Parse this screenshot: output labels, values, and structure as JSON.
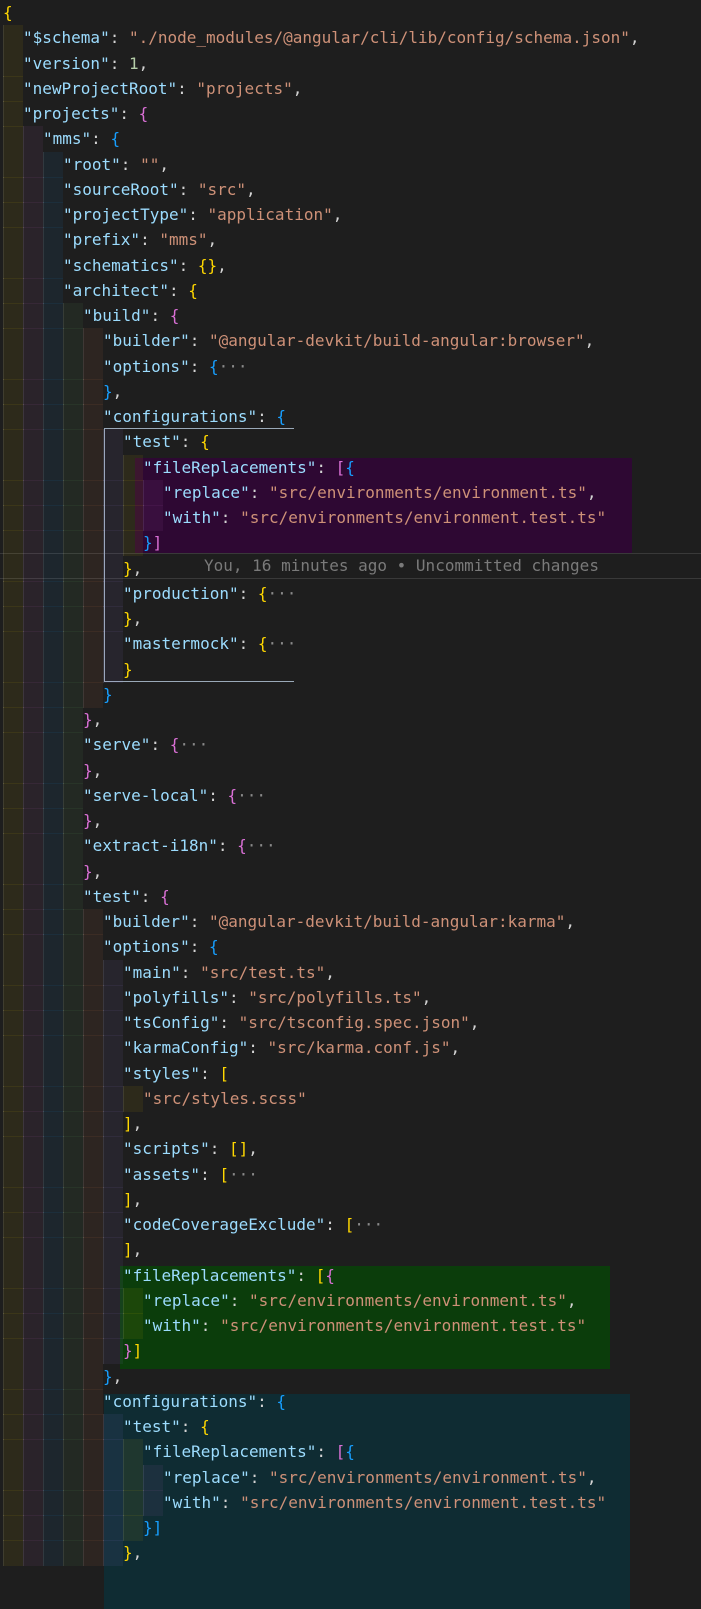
{
  "editor": {
    "blame": "You, 16 minutes ago • Uncommitted changes",
    "lines": [
      {
        "i": 0,
        "t": [
          [
            "p",
            "{",
            1
          ]
        ]
      },
      {
        "i": 1,
        "t": [
          [
            "k",
            "\"$schema\""
          ],
          [
            "w",
            ": "
          ],
          [
            "s",
            "\"./node_modules/@angular/cli/lib/config/schema.json\""
          ],
          [
            "w",
            ","
          ]
        ]
      },
      {
        "i": 1,
        "t": [
          [
            "k",
            "\"version\""
          ],
          [
            "w",
            ": "
          ],
          [
            "n",
            "1"
          ],
          [
            "w",
            ","
          ]
        ]
      },
      {
        "i": 1,
        "t": [
          [
            "k",
            "\"newProjectRoot\""
          ],
          [
            "w",
            ": "
          ],
          [
            "s",
            "\"projects\""
          ],
          [
            "w",
            ","
          ]
        ]
      },
      {
        "i": 1,
        "t": [
          [
            "k",
            "\"projects\""
          ],
          [
            "w",
            ": "
          ],
          [
            "p",
            "{",
            2
          ]
        ]
      },
      {
        "i": 2,
        "t": [
          [
            "k",
            "\"mms\""
          ],
          [
            "w",
            ": "
          ],
          [
            "p",
            "{",
            3
          ]
        ]
      },
      {
        "i": 3,
        "t": [
          [
            "k",
            "\"root\""
          ],
          [
            "w",
            ": "
          ],
          [
            "s",
            "\"\""
          ],
          [
            "w",
            ","
          ]
        ]
      },
      {
        "i": 3,
        "t": [
          [
            "k",
            "\"sourceRoot\""
          ],
          [
            "w",
            ": "
          ],
          [
            "s",
            "\"src\""
          ],
          [
            "w",
            ","
          ]
        ]
      },
      {
        "i": 3,
        "t": [
          [
            "k",
            "\"projectType\""
          ],
          [
            "w",
            ": "
          ],
          [
            "s",
            "\"application\""
          ],
          [
            "w",
            ","
          ]
        ]
      },
      {
        "i": 3,
        "t": [
          [
            "k",
            "\"prefix\""
          ],
          [
            "w",
            ": "
          ],
          [
            "s",
            "\"mms\""
          ],
          [
            "w",
            ","
          ]
        ]
      },
      {
        "i": 3,
        "t": [
          [
            "k",
            "\"schematics\""
          ],
          [
            "w",
            ": "
          ],
          [
            "p",
            "{}",
            1
          ],
          [
            "w",
            ","
          ]
        ]
      },
      {
        "i": 3,
        "t": [
          [
            "k",
            "\"architect\""
          ],
          [
            "w",
            ": "
          ],
          [
            "p",
            "{",
            1
          ]
        ]
      },
      {
        "i": 4,
        "t": [
          [
            "k",
            "\"build\""
          ],
          [
            "w",
            ": "
          ],
          [
            "p",
            "{",
            2
          ]
        ]
      },
      {
        "i": 5,
        "t": [
          [
            "k",
            "\"builder\""
          ],
          [
            "w",
            ": "
          ],
          [
            "s",
            "\"@angular-devkit/build-angular:browser\""
          ],
          [
            "w",
            ","
          ]
        ]
      },
      {
        "i": 5,
        "t": [
          [
            "k",
            "\"options\""
          ],
          [
            "w",
            ": "
          ],
          [
            "p",
            "{",
            3
          ],
          [
            "f",
            "···"
          ]
        ]
      },
      {
        "i": 5,
        "t": [
          [
            "p",
            "}",
            3
          ],
          [
            "w",
            ","
          ]
        ]
      },
      {
        "i": 5,
        "t": [
          [
            "k",
            "\"configurations\""
          ],
          [
            "w",
            ": "
          ],
          [
            "p",
            "{",
            3
          ]
        ]
      },
      {
        "i": 6,
        "t": [
          [
            "k",
            "\"test\""
          ],
          [
            "w",
            ": "
          ],
          [
            "p",
            "{",
            1
          ]
        ]
      },
      {
        "i": 7,
        "t": [
          [
            "k",
            "\"fileReplacements\""
          ],
          [
            "w",
            ": "
          ],
          [
            "p",
            "[",
            2
          ],
          [
            "p",
            "{",
            3
          ]
        ]
      },
      {
        "i": 8,
        "t": [
          [
            "k",
            "\"replace\""
          ],
          [
            "w",
            ": "
          ],
          [
            "s",
            "\"src/environments/environment.ts\""
          ],
          [
            "w",
            ","
          ]
        ]
      },
      {
        "i": 8,
        "t": [
          [
            "k",
            "\"with\""
          ],
          [
            "w",
            ": "
          ],
          [
            "s",
            "\"src/environments/environment.test.ts\""
          ]
        ]
      },
      {
        "i": 7,
        "t": [
          [
            "p",
            "}",
            3
          ],
          [
            "p",
            "]",
            2
          ]
        ]
      },
      {
        "i": 6,
        "t": [
          [
            "p",
            "}",
            1
          ],
          [
            "w",
            ","
          ]
        ]
      },
      {
        "i": 6,
        "t": [
          [
            "k",
            "\"production\""
          ],
          [
            "w",
            ": "
          ],
          [
            "p",
            "{",
            1
          ],
          [
            "f",
            "···"
          ]
        ]
      },
      {
        "i": 6,
        "t": [
          [
            "p",
            "}",
            1
          ],
          [
            "w",
            ","
          ]
        ]
      },
      {
        "i": 6,
        "t": [
          [
            "k",
            "\"mastermock\""
          ],
          [
            "w",
            ": "
          ],
          [
            "p",
            "{",
            1
          ],
          [
            "f",
            "···"
          ]
        ]
      },
      {
        "i": 6,
        "t": [
          [
            "p",
            "}",
            1
          ]
        ]
      },
      {
        "i": 5,
        "t": [
          [
            "p",
            "}",
            3
          ]
        ]
      },
      {
        "i": 4,
        "t": [
          [
            "p",
            "}",
            2
          ],
          [
            "w",
            ","
          ]
        ]
      },
      {
        "i": 4,
        "t": [
          [
            "k",
            "\"serve\""
          ],
          [
            "w",
            ": "
          ],
          [
            "p",
            "{",
            2
          ],
          [
            "f",
            "···"
          ]
        ]
      },
      {
        "i": 4,
        "t": [
          [
            "p",
            "}",
            2
          ],
          [
            "w",
            ","
          ]
        ]
      },
      {
        "i": 4,
        "t": [
          [
            "k",
            "\"serve-local\""
          ],
          [
            "w",
            ": "
          ],
          [
            "p",
            "{",
            2
          ],
          [
            "f",
            "···"
          ]
        ]
      },
      {
        "i": 4,
        "t": [
          [
            "p",
            "}",
            2
          ],
          [
            "w",
            ","
          ]
        ]
      },
      {
        "i": 4,
        "t": [
          [
            "k",
            "\"extract-i18n\""
          ],
          [
            "w",
            ": "
          ],
          [
            "p",
            "{",
            2
          ],
          [
            "f",
            "···"
          ]
        ]
      },
      {
        "i": 4,
        "t": [
          [
            "p",
            "}",
            2
          ],
          [
            "w",
            ","
          ]
        ]
      },
      {
        "i": 4,
        "t": [
          [
            "k",
            "\"test\""
          ],
          [
            "w",
            ": "
          ],
          [
            "p",
            "{",
            2
          ]
        ]
      },
      {
        "i": 5,
        "t": [
          [
            "k",
            "\"builder\""
          ],
          [
            "w",
            ": "
          ],
          [
            "s",
            "\"@angular-devkit/build-angular:karma\""
          ],
          [
            "w",
            ","
          ]
        ]
      },
      {
        "i": 5,
        "t": [
          [
            "k",
            "\"options\""
          ],
          [
            "w",
            ": "
          ],
          [
            "p",
            "{",
            3
          ]
        ]
      },
      {
        "i": 6,
        "t": [
          [
            "k",
            "\"main\""
          ],
          [
            "w",
            ": "
          ],
          [
            "s",
            "\"src/test.ts\""
          ],
          [
            "w",
            ","
          ]
        ]
      },
      {
        "i": 6,
        "t": [
          [
            "k",
            "\"polyfills\""
          ],
          [
            "w",
            ": "
          ],
          [
            "s",
            "\"src/polyfills.ts\""
          ],
          [
            "w",
            ","
          ]
        ]
      },
      {
        "i": 6,
        "t": [
          [
            "k",
            "\"tsConfig\""
          ],
          [
            "w",
            ": "
          ],
          [
            "s",
            "\"src/tsconfig.spec.json\""
          ],
          [
            "w",
            ","
          ]
        ]
      },
      {
        "i": 6,
        "t": [
          [
            "k",
            "\"karmaConfig\""
          ],
          [
            "w",
            ": "
          ],
          [
            "s",
            "\"src/karma.conf.js\""
          ],
          [
            "w",
            ","
          ]
        ]
      },
      {
        "i": 6,
        "t": [
          [
            "k",
            "\"styles\""
          ],
          [
            "w",
            ": "
          ],
          [
            "p",
            "[",
            1
          ]
        ]
      },
      {
        "i": 7,
        "t": [
          [
            "s",
            "\"src/styles.scss\""
          ]
        ]
      },
      {
        "i": 6,
        "t": [
          [
            "p",
            "]",
            1
          ],
          [
            "w",
            ","
          ]
        ]
      },
      {
        "i": 6,
        "t": [
          [
            "k",
            "\"scripts\""
          ],
          [
            "w",
            ": "
          ],
          [
            "p",
            "[]",
            1
          ],
          [
            "w",
            ","
          ]
        ]
      },
      {
        "i": 6,
        "t": [
          [
            "k",
            "\"assets\""
          ],
          [
            "w",
            ": "
          ],
          [
            "p",
            "[",
            1
          ],
          [
            "f",
            "···"
          ]
        ]
      },
      {
        "i": 6,
        "t": [
          [
            "p",
            "]",
            1
          ],
          [
            "w",
            ","
          ]
        ]
      },
      {
        "i": 6,
        "t": [
          [
            "k",
            "\"codeCoverageExclude\""
          ],
          [
            "w",
            ": "
          ],
          [
            "p",
            "[",
            1
          ],
          [
            "f",
            "···"
          ]
        ]
      },
      {
        "i": 6,
        "t": [
          [
            "p",
            "]",
            1
          ],
          [
            "w",
            ","
          ]
        ]
      },
      {
        "i": 6,
        "t": [
          [
            "k",
            "\"fileReplacements\""
          ],
          [
            "w",
            ": "
          ],
          [
            "p",
            "[",
            1
          ],
          [
            "p",
            "{",
            2
          ]
        ]
      },
      {
        "i": 7,
        "t": [
          [
            "k",
            "\"replace\""
          ],
          [
            "w",
            ": "
          ],
          [
            "s",
            "\"src/environments/environment.ts\""
          ],
          [
            "w",
            ","
          ]
        ]
      },
      {
        "i": 7,
        "t": [
          [
            "k",
            "\"with\""
          ],
          [
            "w",
            ": "
          ],
          [
            "s",
            "\"src/environments/environment.test.ts\""
          ]
        ]
      },
      {
        "i": 6,
        "t": [
          [
            "p",
            "}",
            2
          ],
          [
            "p",
            "]",
            1
          ]
        ]
      },
      {
        "i": 5,
        "t": [
          [
            "p",
            "}",
            3
          ],
          [
            "w",
            ","
          ]
        ]
      },
      {
        "i": 5,
        "t": [
          [
            "k",
            "\"configurations\""
          ],
          [
            "w",
            ": "
          ],
          [
            "p",
            "{",
            3
          ]
        ]
      },
      {
        "i": 6,
        "t": [
          [
            "k",
            "\"test\""
          ],
          [
            "w",
            ": "
          ],
          [
            "p",
            "{",
            1
          ]
        ]
      },
      {
        "i": 7,
        "t": [
          [
            "k",
            "\"fileReplacements\""
          ],
          [
            "w",
            ": "
          ],
          [
            "p",
            "[",
            2
          ],
          [
            "p",
            "{",
            3
          ]
        ]
      },
      {
        "i": 8,
        "t": [
          [
            "k",
            "\"replace\""
          ],
          [
            "w",
            ": "
          ],
          [
            "s",
            "\"src/environments/environment.ts\""
          ],
          [
            "w",
            ","
          ]
        ]
      },
      {
        "i": 8,
        "t": [
          [
            "k",
            "\"with\""
          ],
          [
            "w",
            ": "
          ],
          [
            "s",
            "\"src/environments/environment.test.ts\""
          ]
        ]
      },
      {
        "i": 7,
        "t": [
          [
            "p",
            "}",
            3
          ],
          [
            "p",
            "]",
            3
          ]
        ]
      },
      {
        "i": 6,
        "t": [
          [
            "p",
            "}",
            1
          ],
          [
            "w",
            ","
          ]
        ]
      }
    ]
  }
}
